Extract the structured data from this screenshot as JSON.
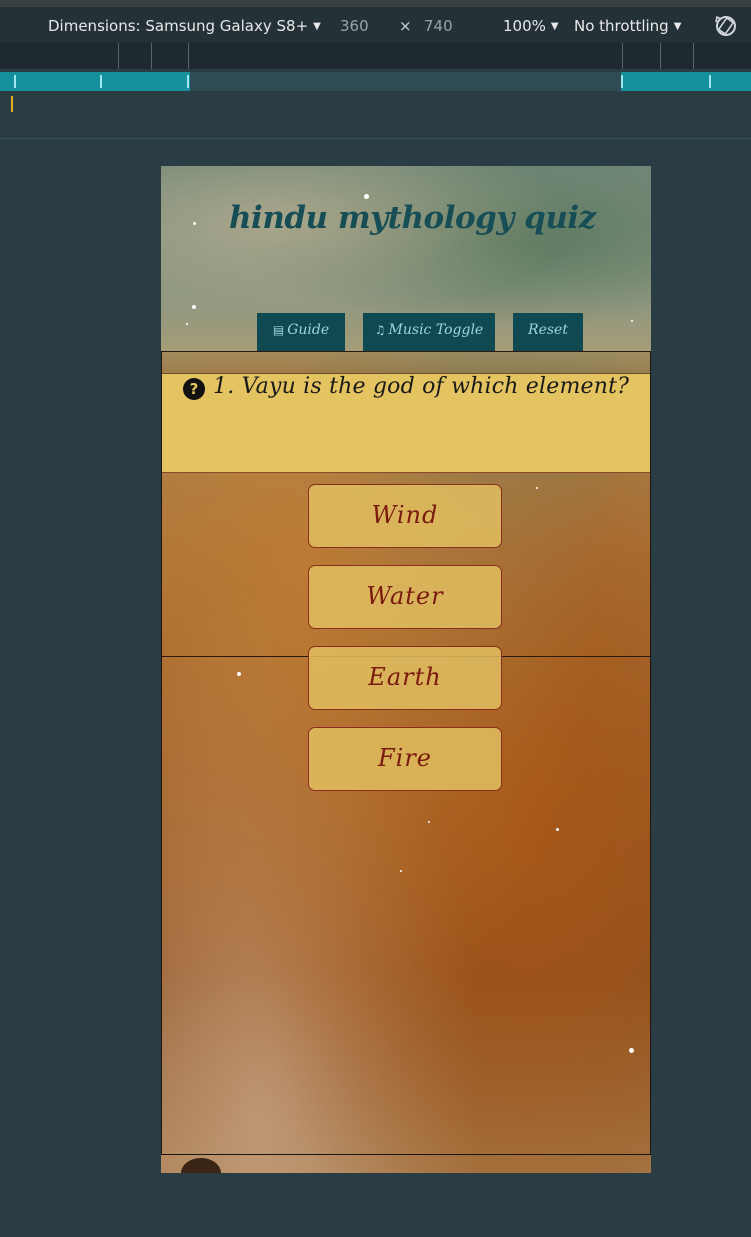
{
  "devtools": {
    "dimensions_label": "Dimensions: Samsung Galaxy S8+",
    "width": "360",
    "times": "×",
    "height": "740",
    "zoom": "100%",
    "throttling": "No throttling",
    "rotate_icon": "rotate-icon"
  },
  "colors": {
    "page_bg": "#2a3d44",
    "nav_button_bg": "#0f4a52",
    "title_color": "#174d55",
    "question_bg": "#e4c460",
    "answer_text": "#7a1a10",
    "media_segment": "#16909c"
  },
  "app": {
    "title": "hindu mythology quiz",
    "nav": [
      {
        "label": "Guide",
        "icon": "table-icon"
      },
      {
        "label": "Music Toggle",
        "icon": "music-note-icon"
      },
      {
        "label": "Reset"
      }
    ],
    "question": {
      "icon": "question-circle-icon",
      "text": "1. Vayu is the god of which element?"
    },
    "answers": [
      "Wind",
      "Water",
      "Earth",
      "Fire"
    ]
  }
}
